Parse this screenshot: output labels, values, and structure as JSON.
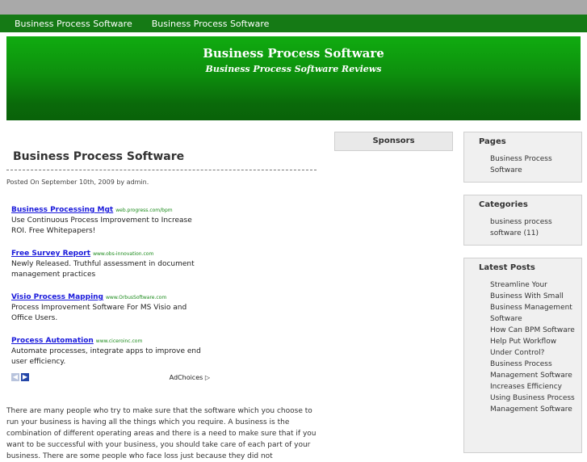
{
  "nav": {
    "items": [
      "Business Process Software",
      "Business Process Software"
    ]
  },
  "header": {
    "title": "Business Process Software",
    "description": "Business Process Software Reviews"
  },
  "post": {
    "title": "Business Process Software",
    "meta": "Posted On September 10th, 2009 by admin.",
    "body": "There are many people who try to make sure that the software which you choose to run your business is having all the things which you require. A business is the combination of different operating areas and there is a need to make sure that if you want to be successful with your business, you should take care of each part of your business. There are some people who face loss just because they did not"
  },
  "ads": [
    {
      "title": "Business Processing Mgt",
      "url": "web.progress.com/bpm",
      "desc": "Use Continuous Process Improvement to Increase ROI. Free Whitepapers!"
    },
    {
      "title": "Free Survey Report",
      "url": "www.obs-innovation.com",
      "desc": "Newly Released. Truthful assessment in document management practices"
    },
    {
      "title": "Visio Process Mapping",
      "url": "www.OrbusSoftware.com",
      "desc": "Process Improvement Software For MS Visio and Office Users."
    },
    {
      "title": "Process Automation",
      "url": "www.ciceroinc.com",
      "desc": "Automate processes, integrate apps to improve end user efficiency."
    }
  ],
  "adchoices": "AdChoices",
  "sidebar": {
    "sponsors": "Sponsors",
    "pages": {
      "title": "Pages",
      "items": [
        "Business Process Software"
      ]
    },
    "categories": {
      "title": "Categories",
      "items": [
        "business process software (11)"
      ]
    },
    "latest": {
      "title": "Latest Posts",
      "items": [
        "Streamline Your Business With Small Business Management Software",
        "How Can BPM Software Help Put Workflow Under Control?",
        "Business Process Management Software Increases Efficiency",
        "Using Business Process Management Software"
      ]
    }
  }
}
